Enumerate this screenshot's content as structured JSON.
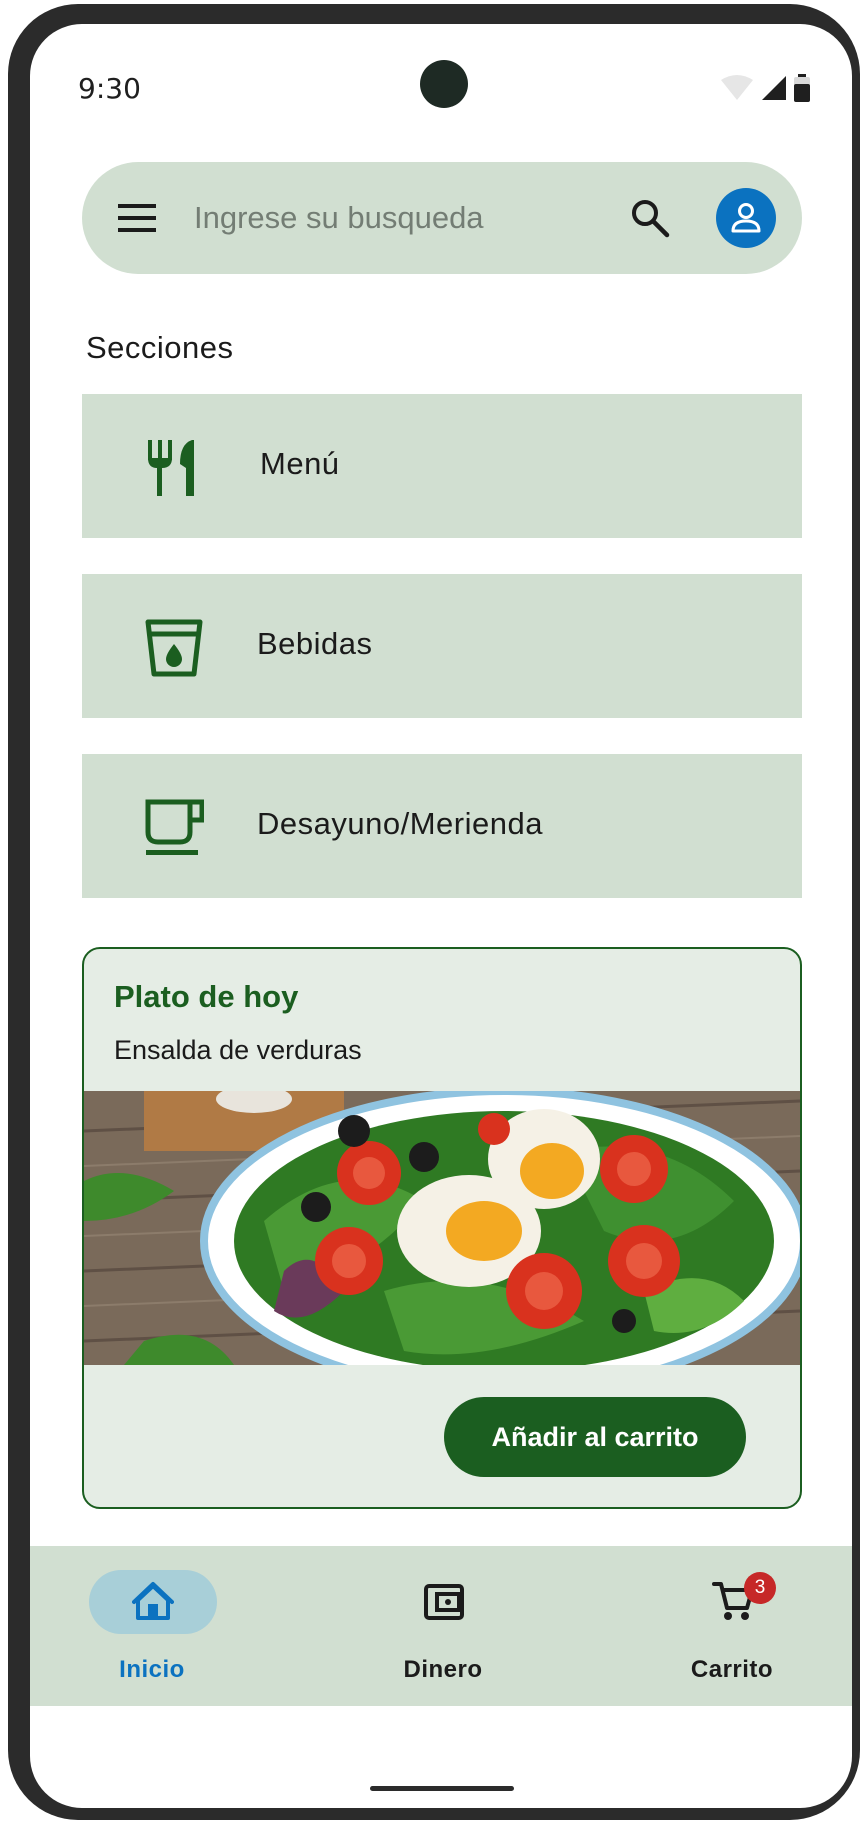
{
  "status_bar": {
    "time": "9:30"
  },
  "search": {
    "placeholder": "Ingrese su busqueda"
  },
  "sections": {
    "title": "Secciones",
    "items": [
      {
        "label": "Menú",
        "icon": "restaurant-icon"
      },
      {
        "label": "Bebidas",
        "icon": "drink-icon"
      },
      {
        "label": "Desayuno/Merienda",
        "icon": "coffee-icon"
      }
    ]
  },
  "daily_dish": {
    "title": "Plato de hoy",
    "subtitle": "Ensalda de verduras",
    "image": "salad-image",
    "button_label": "Añadir al carrito"
  },
  "bottom_nav": {
    "items": [
      {
        "label": "Inicio",
        "icon": "home-icon",
        "active": true
      },
      {
        "label": "Dinero",
        "icon": "wallet-icon",
        "active": false
      },
      {
        "label": "Carrito",
        "icon": "cart-icon",
        "active": false,
        "badge": "3"
      }
    ]
  },
  "colors": {
    "primary": "#1b5e20",
    "surface": "#d1dfd1",
    "card": "#e5ede5",
    "active": "#0b72c0",
    "badge": "#c62828"
  }
}
